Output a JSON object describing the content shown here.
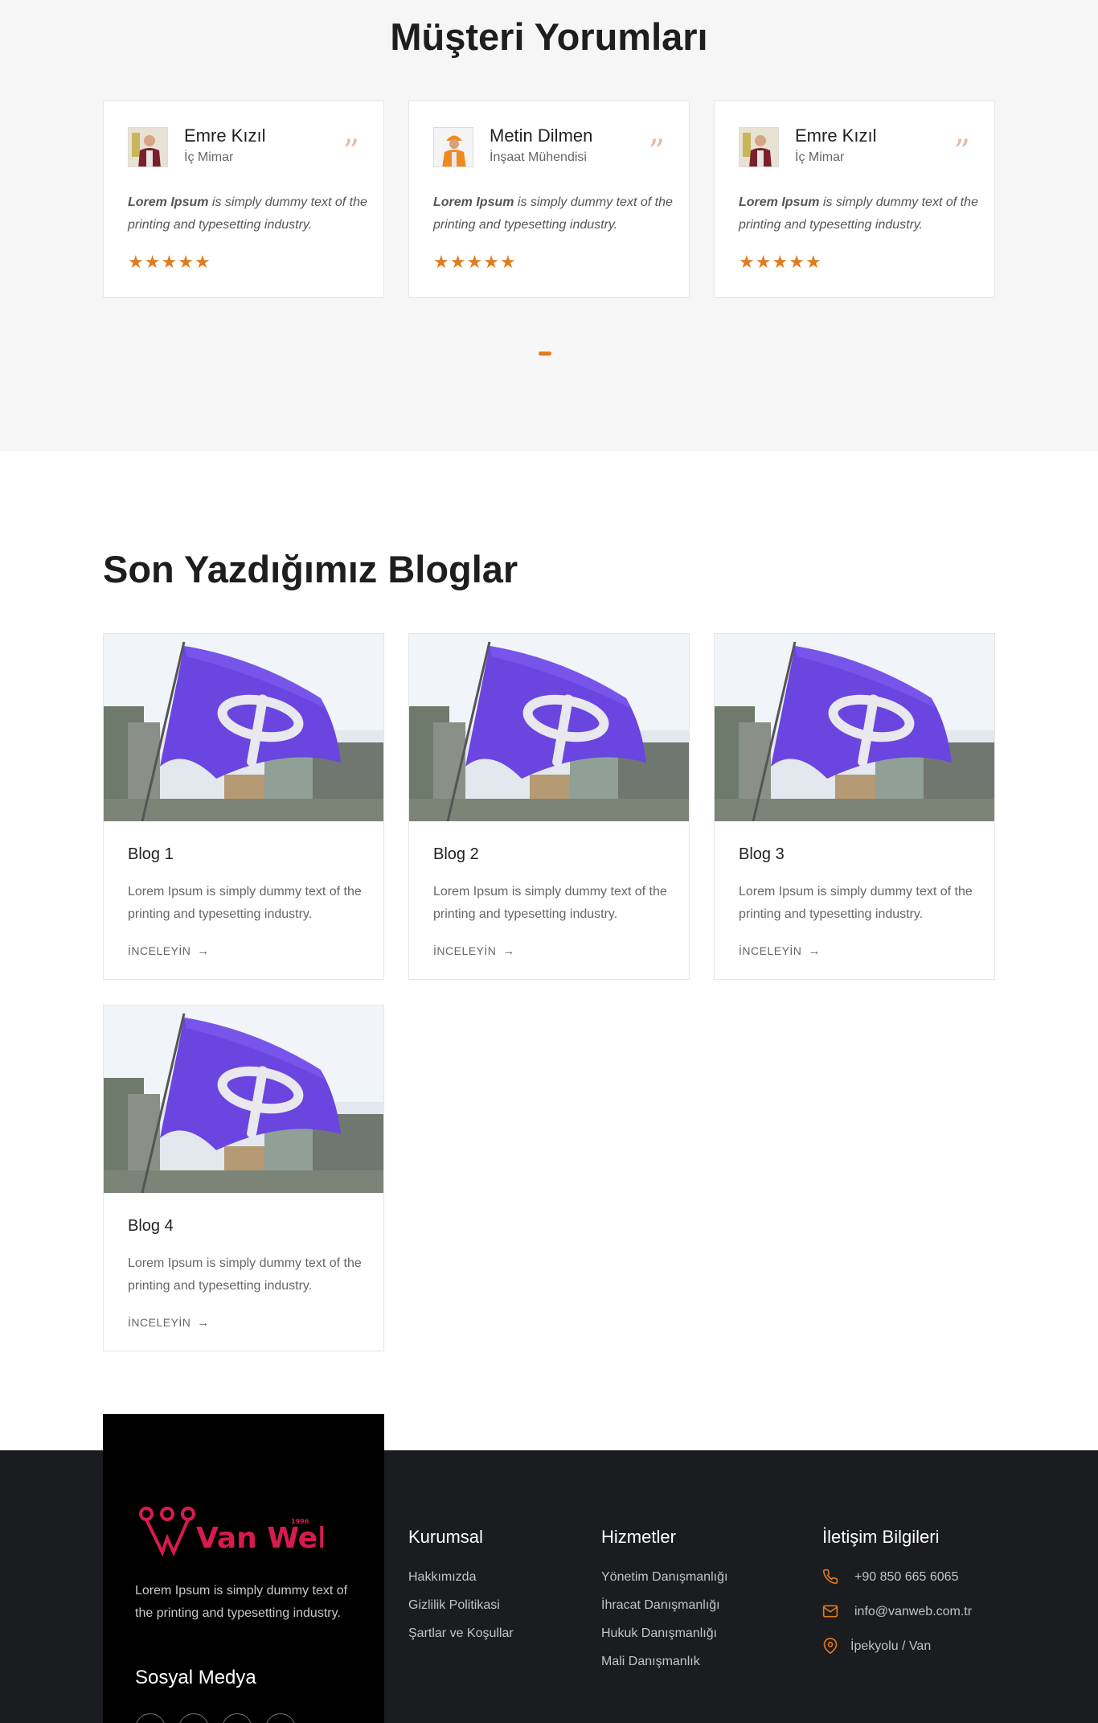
{
  "testimonials": {
    "title": "Müşteri Yorumları",
    "items": [
      {
        "name": "Emre Kızıl",
        "role": "İç Mimar",
        "text_bold": "Lorem Ipsum",
        "text_rest": " is simply dummy text of the printing and typesetting industry.",
        "rating": 5
      },
      {
        "name": "Metin Dilmen",
        "role": "İnşaat Mühendisi",
        "text_bold": "Lorem Ipsum",
        "text_rest": " is simply dummy text of the printing and typesetting industry.",
        "rating": 5
      },
      {
        "name": "Emre Kızıl",
        "role": "İç Mimar",
        "text_bold": "Lorem Ipsum",
        "text_rest": " is simply dummy text of the printing and typesetting industry.",
        "rating": 5
      }
    ],
    "quote_icon": "quote-icon",
    "star_icon": "star-icon",
    "accent_color": "#e07b1e"
  },
  "blogs": {
    "title": "Son Yazdığımız Bloglar",
    "items": [
      {
        "title": "Blog 1",
        "text": "Lorem Ipsum is simply dummy text of the printing and typesetting industry.",
        "link": "İNCELEYİN"
      },
      {
        "title": "Blog 2",
        "text": "Lorem Ipsum is simply dummy text of the printing and typesetting industry.",
        "link": "İNCELEYİN"
      },
      {
        "title": "Blog 3",
        "text": "Lorem Ipsum is simply dummy text of the printing and typesetting industry.",
        "link": "İNCELEYİN"
      },
      {
        "title": "Blog 4",
        "text": "Lorem Ipsum is simply dummy text of the printing and typesetting industry.",
        "link": "İNCELEYİN"
      }
    ],
    "link_arrow": "→",
    "image_subject": "purple flag with white logo",
    "flag_color": "#6a45e0"
  },
  "footer": {
    "brand": {
      "logo_text": "Van Web",
      "logo_year": "1996",
      "logo_color": "#d81b4f",
      "description": "Lorem Ipsum is simply dummy text of the printing and typesetting industry.",
      "social_title": "Sosyal Medya"
    },
    "corporate": {
      "title": "Kurumsal",
      "links": [
        "Hakkımızda",
        "Gizlilik Politikasi",
        "Şartlar ve Koşullar"
      ]
    },
    "services": {
      "title": "Hizmetler",
      "links": [
        "Yönetim Danışmanlığı",
        "İhracat Danışmanlığı",
        "Hukuk Danışmanlığı",
        "Mali Danışmanlık"
      ]
    },
    "contact": {
      "title": "İletişim Bilgileri",
      "phone": "+90 850 665 6065",
      "email": "info@vanweb.com.tr",
      "address": "İpekyolu / Van",
      "icon_color": "#e07b1e"
    }
  }
}
